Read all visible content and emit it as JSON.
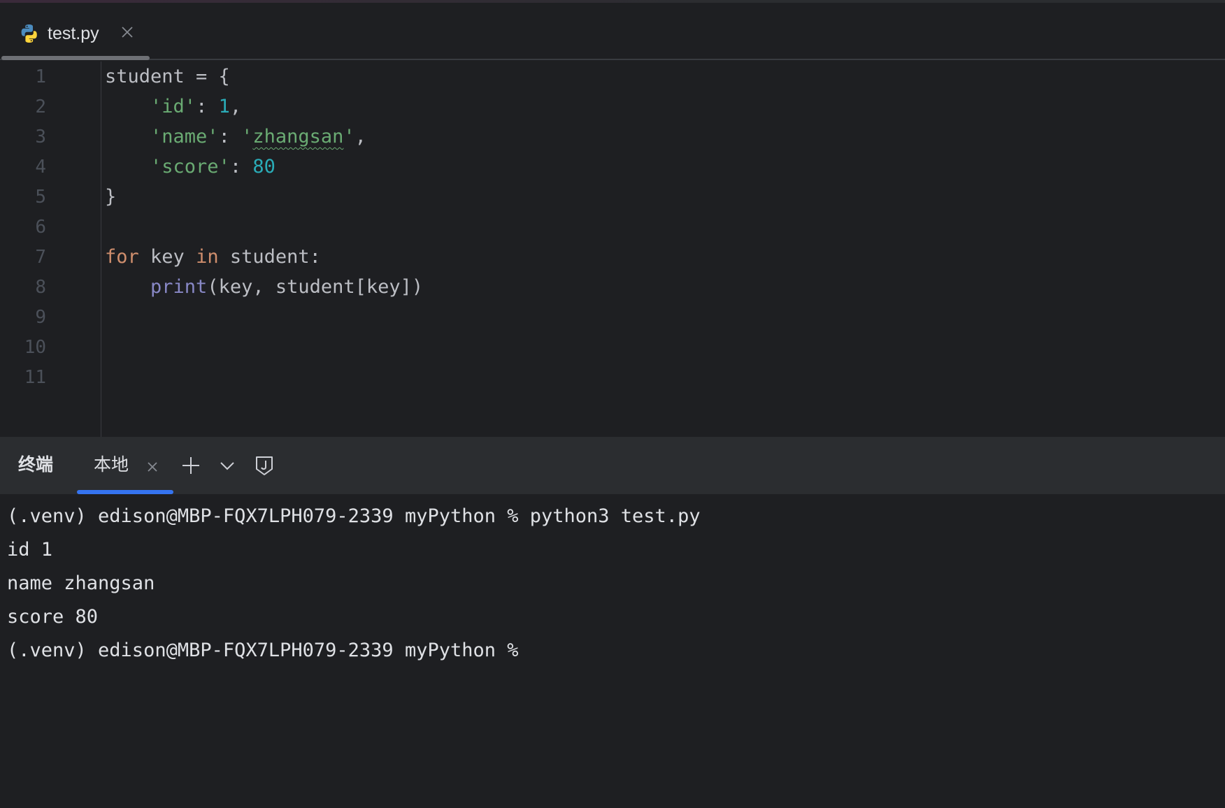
{
  "editor": {
    "tab": {
      "label": "test.py",
      "icon": "python-file-icon"
    },
    "lines": [
      {
        "num": "1",
        "tokens": [
          {
            "t": "student = {",
            "c": "plain"
          }
        ]
      },
      {
        "num": "2",
        "tokens": [
          {
            "t": "    ",
            "c": "plain"
          },
          {
            "t": "'id'",
            "c": "str"
          },
          {
            "t": ": ",
            "c": "plain"
          },
          {
            "t": "1",
            "c": "num"
          },
          {
            "t": ",",
            "c": "plain"
          }
        ]
      },
      {
        "num": "3",
        "tokens": [
          {
            "t": "    ",
            "c": "plain"
          },
          {
            "t": "'name'",
            "c": "str"
          },
          {
            "t": ": ",
            "c": "plain"
          },
          {
            "t": "'",
            "c": "str"
          },
          {
            "t": "zhangsan",
            "c": "str squiggle"
          },
          {
            "t": "'",
            "c": "str"
          },
          {
            "t": ",",
            "c": "plain"
          }
        ]
      },
      {
        "num": "4",
        "tokens": [
          {
            "t": "    ",
            "c": "plain"
          },
          {
            "t": "'score'",
            "c": "str"
          },
          {
            "t": ": ",
            "c": "plain"
          },
          {
            "t": "80",
            "c": "num"
          }
        ]
      },
      {
        "num": "5",
        "tokens": [
          {
            "t": "}",
            "c": "plain"
          }
        ]
      },
      {
        "num": "6",
        "tokens": []
      },
      {
        "num": "7",
        "tokens": [
          {
            "t": "for",
            "c": "kw"
          },
          {
            "t": " key ",
            "c": "plain"
          },
          {
            "t": "in",
            "c": "kw"
          },
          {
            "t": " student:",
            "c": "plain"
          }
        ]
      },
      {
        "num": "8",
        "tokens": [
          {
            "t": "    ",
            "c": "plain"
          },
          {
            "t": "print",
            "c": "fn"
          },
          {
            "t": "(key, student[key])",
            "c": "plain"
          }
        ]
      },
      {
        "num": "9",
        "tokens": []
      },
      {
        "num": "10",
        "tokens": []
      },
      {
        "num": "11",
        "tokens": []
      }
    ]
  },
  "terminal": {
    "title": "终端",
    "tab_label": "本地",
    "buttons": {
      "new_tab": "plus-icon",
      "dropdown": "chevron-down-icon",
      "shield": "shield-icon"
    },
    "output": [
      "(.venv) edison@MBP-FQX7LPH079-2339 myPython % python3 test.py",
      "id 1",
      "name zhangsan",
      "score 80",
      "(.venv) edison@MBP-FQX7LPH079-2339 myPython %"
    ]
  },
  "colors": {
    "background": "#1e1f22",
    "string": "#6aab73",
    "number": "#2aacb8",
    "keyword": "#cf8e6d",
    "builtin": "#8888c6",
    "accent": "#3574f0"
  }
}
